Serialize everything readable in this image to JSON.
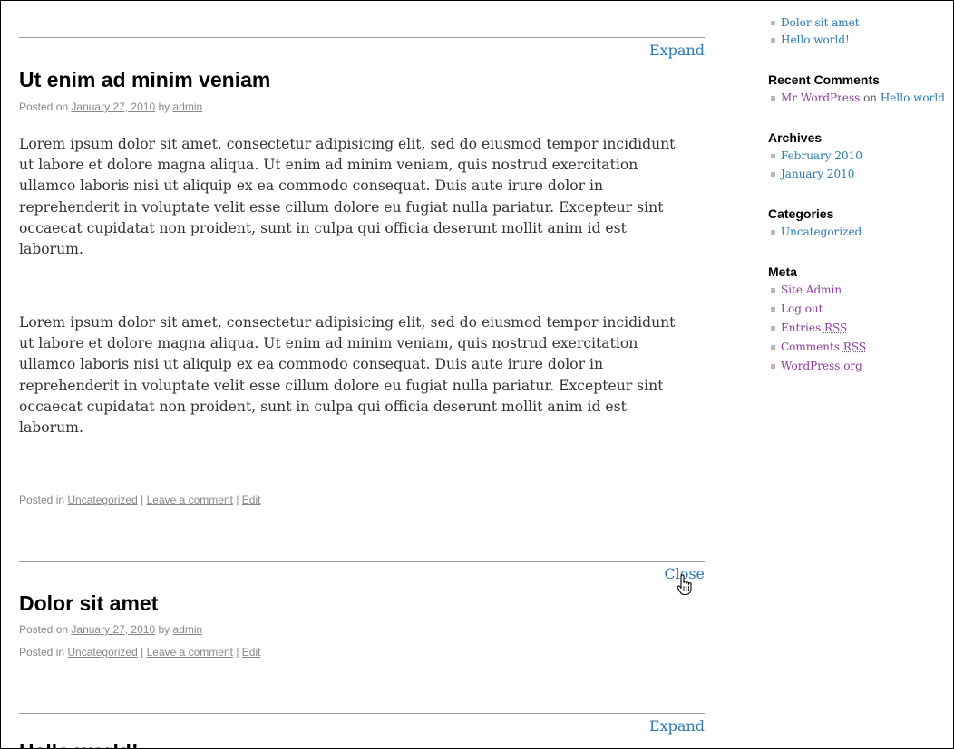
{
  "posts": [
    {
      "toggle": "Expand",
      "title": "Ut enim ad minim veniam",
      "posted_on": "Posted on",
      "date": "January 27, 2010",
      "by": "by",
      "author": "admin",
      "paragraphs": [
        "Lorem ipsum dolor sit amet, consectetur adipisicing elit, sed do eiusmod tempor incididunt ut labore et dolore magna aliqua. Ut enim ad minim veniam, quis nostrud exercitation ullamco laboris nisi ut aliquip ex ea commodo consequat. Duis aute irure dolor in reprehenderit in voluptate velit esse cillum dolore eu fugiat nulla pariatur. Excepteur sint occaecat cupidatat non proident, sunt in culpa qui officia deserunt mollit anim id est laborum.",
        "Lorem ipsum dolor sit amet, consectetur adipisicing elit, sed do eiusmod tempor incididunt ut labore et dolore magna aliqua. Ut enim ad minim veniam, quis nostrud exercitation ullamco laboris nisi ut aliquip ex ea commodo consequat. Duis aute irure dolor in reprehenderit in voluptate velit esse cillum dolore eu fugiat nulla pariatur. Excepteur sint occaecat cupidatat non proident, sunt in culpa qui officia deserunt mollit anim id est laborum."
      ],
      "posted_in": "Posted in",
      "category": "Uncategorized",
      "sep": "|",
      "comment": "Leave a comment",
      "edit": "Edit"
    },
    {
      "toggle": "Close",
      "title": "Dolor sit amet",
      "posted_on": "Posted on",
      "date": "January 27, 2010",
      "by": "by",
      "author": "admin",
      "posted_in": "Posted in",
      "category": "Uncategorized",
      "sep": "|",
      "comment": "Leave a comment",
      "edit": "Edit"
    },
    {
      "toggle": "Expand",
      "title": "Hello world!"
    }
  ],
  "sidebar": {
    "recent_posts": [
      "Dolor sit amet",
      "Hello world!"
    ],
    "recent_comments": {
      "title": "Recent Comments",
      "author": "Mr WordPress",
      "on": "on",
      "post": "Hello world"
    },
    "archives": {
      "title": "Archives",
      "items": [
        "February 2010",
        "January 2010"
      ]
    },
    "categories": {
      "title": "Categories",
      "items": [
        "Uncategorized"
      ]
    },
    "meta": {
      "title": "Meta",
      "site_admin": "Site Admin",
      "log_out": "Log out",
      "entries": "Entries",
      "comments": "Comments",
      "rss": "RSS",
      "wordpress": "WordPress.org"
    }
  },
  "colors": {
    "link_blue": "#2a7ab0",
    "link_purple": "#8e3c9c",
    "meta_gray": "#888888",
    "rule_gray": "#9a9a9a"
  },
  "cursor": "hand-pointer-icon"
}
